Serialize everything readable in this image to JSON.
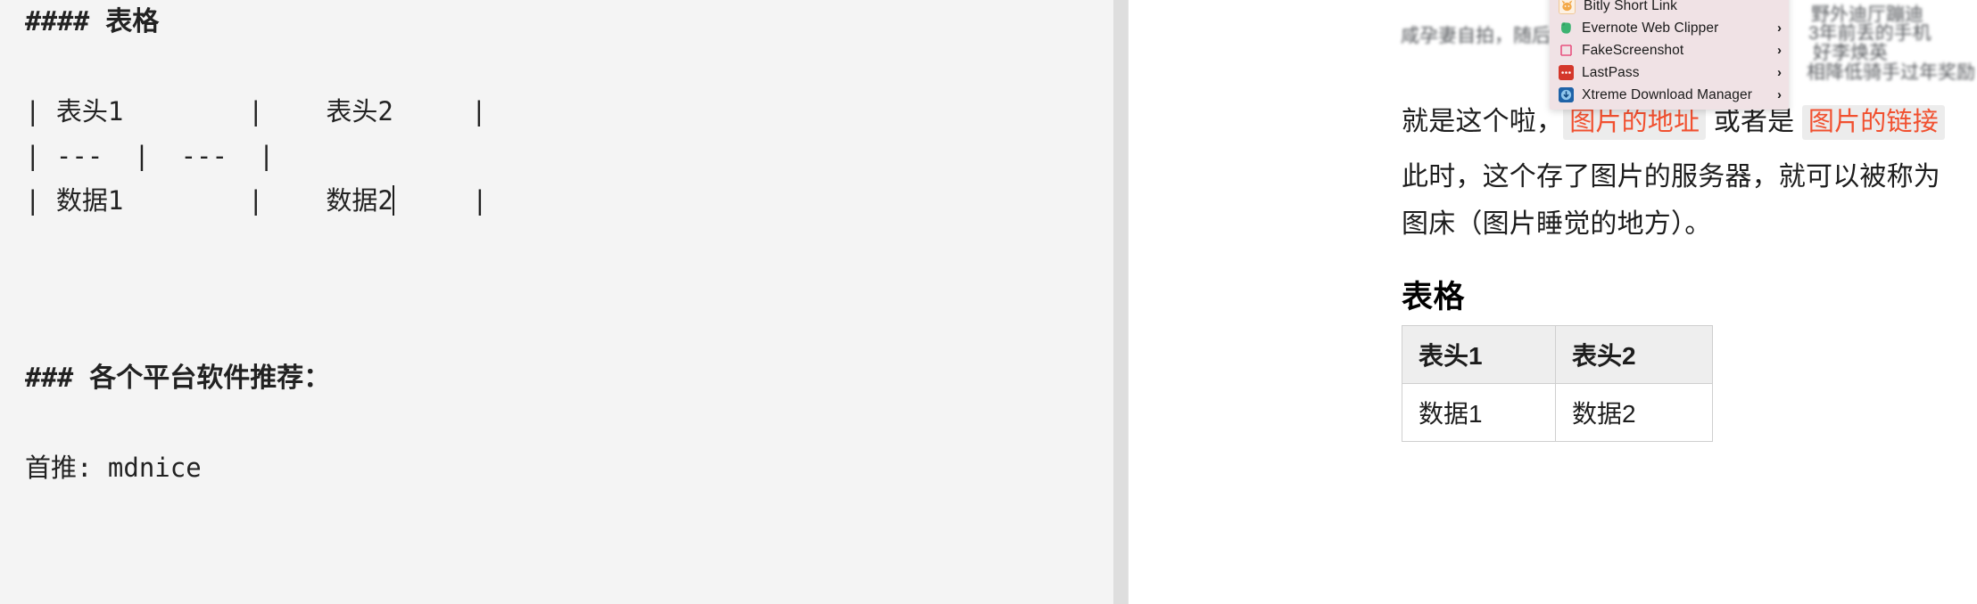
{
  "editor": {
    "lines": [
      {
        "text": "#### 表格",
        "style": "heading"
      },
      {
        "text": "",
        "style": "blank"
      },
      {
        "text": "| 表头1        |    表头2     |",
        "style": "plain"
      },
      {
        "text": "| ---  |  ---  |",
        "style": "plain"
      },
      {
        "text": "| 数据1        |    数据2",
        "style": "plain",
        "caret_after": true,
        "tail": "     |"
      },
      {
        "text": "",
        "style": "blank"
      },
      {
        "text": "",
        "style": "blank"
      },
      {
        "text": "",
        "style": "blank"
      },
      {
        "text": "### 各个平台软件推荐：",
        "style": "heading"
      },
      {
        "text": "",
        "style": "blank"
      },
      {
        "text": "首推: mdnice",
        "style": "plain"
      }
    ]
  },
  "preview": {
    "blurred_background": [
      "咸孕妻自拍，随后将",
      "野外迪厅蹦迪",
      "3年前丢的手机",
      "好李焕英",
      "相降低骑手过年奖励"
    ],
    "paragraph_1": {
      "pre": "就是这个啦，",
      "code_1": "图片的地址",
      "mid": " 或者是 ",
      "code_2": "图片的链接"
    },
    "paragraph_2_line_1": "此时，这个存了图片的服务器，就可以被称为",
    "paragraph_2_line_2": "图床（图片睡觉的地方）。",
    "section_title": "表格",
    "table": {
      "headers": [
        "表头1",
        "表头2"
      ],
      "rows": [
        [
          "数据1",
          "数据2"
        ]
      ]
    }
  },
  "context_menu": {
    "items": [
      {
        "label": "Bitly Short Link",
        "icon": "bitly-icon",
        "has_submenu": false,
        "arrow": ""
      },
      {
        "label": "Evernote Web Clipper",
        "icon": "evernote-icon",
        "has_submenu": true,
        "arrow": "›"
      },
      {
        "label": "FakeScreenshot",
        "icon": "fakescreenshot-icon",
        "has_submenu": true,
        "arrow": "›"
      },
      {
        "label": "LastPass",
        "icon": "lastpass-icon",
        "has_submenu": true,
        "arrow": "›"
      },
      {
        "label": "Xtreme Download Manager",
        "icon": "xtreme-icon",
        "has_submenu": true,
        "arrow": "›"
      }
    ]
  },
  "colors": {
    "editor_bg": "#f4f4f4",
    "preview_bg": "#ffffff",
    "code_text": "#f1502f",
    "code_bg": "#ececec",
    "menu_bg": "#f0e2e5",
    "table_header_bg": "#eeeeee",
    "table_border": "#cfcfcf",
    "scrollbar": "#dedede"
  }
}
